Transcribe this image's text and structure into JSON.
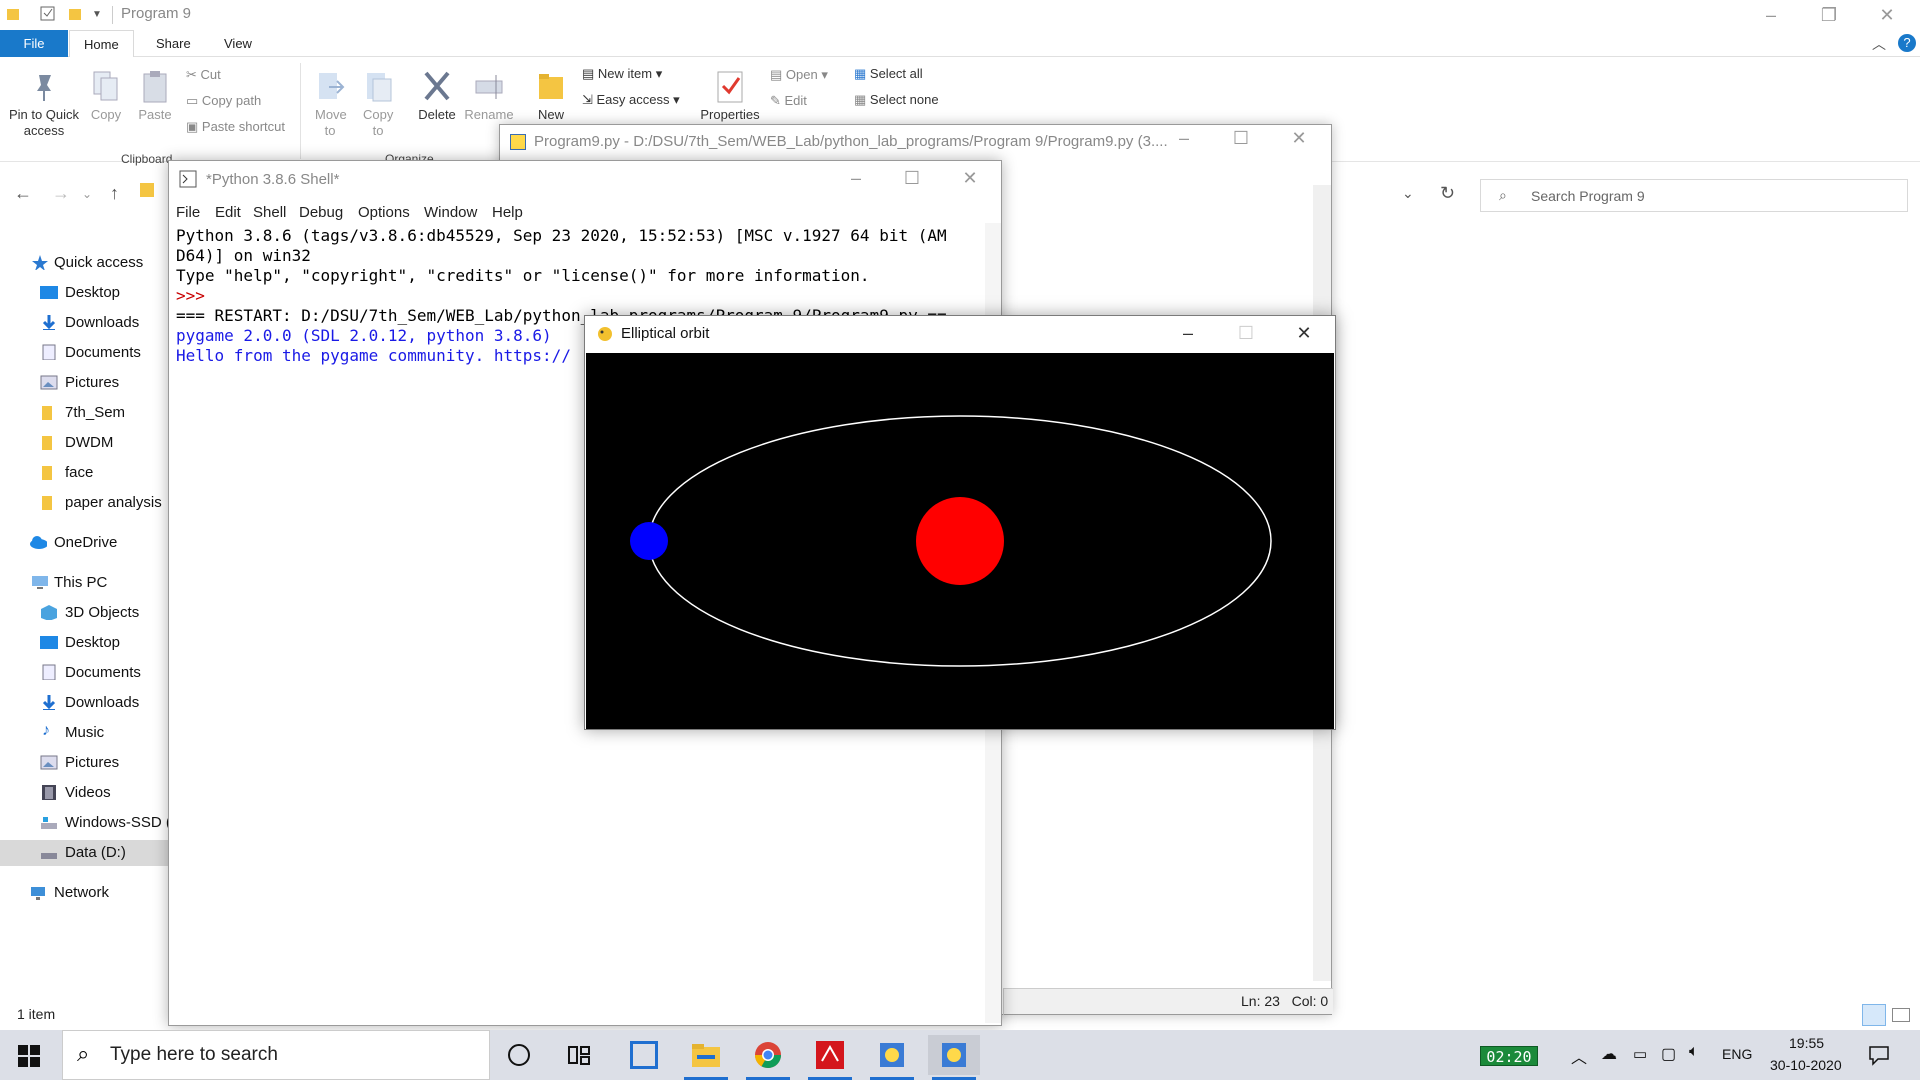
{
  "explorer": {
    "title": "Program 9",
    "tabs": {
      "file": "File",
      "home": "Home",
      "share": "Share",
      "view": "View"
    },
    "ribbon": {
      "pin": "Pin to Quick access",
      "copy": "Copy",
      "paste": "Paste",
      "cut": "Cut",
      "copy_path": "Copy path",
      "paste_shortcut": "Paste shortcut",
      "clipboard_group": "Clipboard",
      "move_to": "Move to",
      "copy_to": "Copy to",
      "delete": "Delete",
      "rename": "Rename",
      "organize_group": "Organize",
      "new_folder": "New",
      "new_item": "New item",
      "easy_access": "Easy access",
      "properties": "Properties",
      "open": "Open",
      "edit": "Edit",
      "select_all": "Select all",
      "select_none": "Select none"
    },
    "search_placeholder": "Search Program 9",
    "nav": {
      "quick_access": "Quick access",
      "qa_items": [
        "Desktop",
        "Downloads",
        "Documents",
        "Pictures",
        "7th_Sem",
        "DWDM",
        "face",
        "paper analysis"
      ],
      "onedrive": "OneDrive",
      "this_pc": "This PC",
      "pc_items": [
        "3D Objects",
        "Desktop",
        "Documents",
        "Downloads",
        "Music",
        "Pictures",
        "Videos",
        "Windows-SSD (",
        "Data (D:)"
      ],
      "network": "Network"
    },
    "status": "1 item"
  },
  "editor": {
    "title": "Program9.py - D:/DSU/7th_Sem/WEB_Lab/python_lab_programs/Program 9/Program9.py (3....",
    "status": "Ln: 23   Col: 0"
  },
  "shell": {
    "title": "*Python 3.8.6 Shell*",
    "menu": [
      "File",
      "Edit",
      "Shell",
      "Debug",
      "Options",
      "Window",
      "Help"
    ],
    "lines": {
      "l1": "Python 3.8.6 (tags/v3.8.6:db45529, Sep 23 2020, 15:52:53) [MSC v.1927 64 bit (AM",
      "l2": "D64)] on win32",
      "l3": "Type \"help\", \"copyright\", \"credits\" or \"license()\" for more information.",
      "prompt": ">>>",
      "restart": "=== RESTART: D:/DSU/7th_Sem/WEB_Lab/python_lab_programs/Program 9/Program9.py ==",
      "pygame": "pygame 2.0.0 (SDL 2.0.12, python 3.8.6)",
      "hello": "Hello from the pygame community. https://"
    }
  },
  "pygame_window": {
    "title": "Elliptical orbit",
    "colors": {
      "background": "#000000",
      "orbit": "#ffffff",
      "sun": "#ff0000",
      "planet": "#0000ff"
    }
  },
  "taskbar": {
    "search_placeholder": "Type here to search",
    "timer": "02:20",
    "lang": "ENG",
    "time": "19:55",
    "date": "30-10-2020"
  }
}
